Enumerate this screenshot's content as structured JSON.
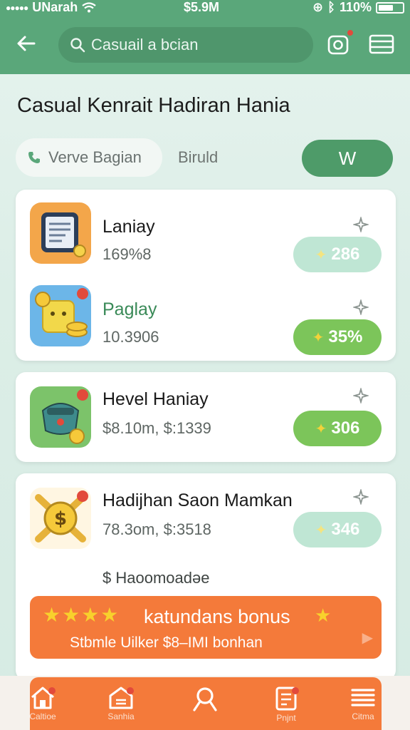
{
  "status": {
    "carrier": "UNarah",
    "time": "$5.9M",
    "battery": "110%"
  },
  "header": {
    "search_placeholder": "Casuail a bcian"
  },
  "page_title": "Casual Kenrait Hadiran Hania",
  "filters": {
    "voice_chip": "Verve Bagian",
    "plain_chip": "Biruld",
    "action_chip": "W"
  },
  "items": [
    {
      "name": "Laniay",
      "sub": "169%8",
      "badge": "286",
      "badge_style": "light"
    },
    {
      "name": "Paglay",
      "sub": "10.3906",
      "badge": "35%",
      "badge_style": "strong"
    },
    {
      "name": "Hevel Haniay",
      "sub": "$8.10m,   $:1339",
      "badge": "306",
      "badge_style": "strong"
    },
    {
      "name": "Hadijhan Saon Mamkan",
      "sub": "78.3om,   $:3518",
      "badge": "346",
      "badge_style": "light",
      "extra": "$ Haoomoadəe"
    }
  ],
  "bonus": {
    "title": "katundans bonus",
    "subtitle": "Stbmle Uilker $8–IMI bonhan"
  },
  "bottom_nav": [
    {
      "icon": "home-icon",
      "label": "Caltioe"
    },
    {
      "icon": "store-icon",
      "label": "Sanhia"
    },
    {
      "icon": "search-icon",
      "label": ""
    },
    {
      "icon": "document-icon",
      "label": "Pnjnt"
    },
    {
      "icon": "menu-icon",
      "label": "Citma"
    }
  ],
  "colors": {
    "header_green": "#5aa77a",
    "accent_orange": "#f47a3a",
    "pill_strong": "#7cc55a",
    "pill_light": "#bfe6d4"
  }
}
